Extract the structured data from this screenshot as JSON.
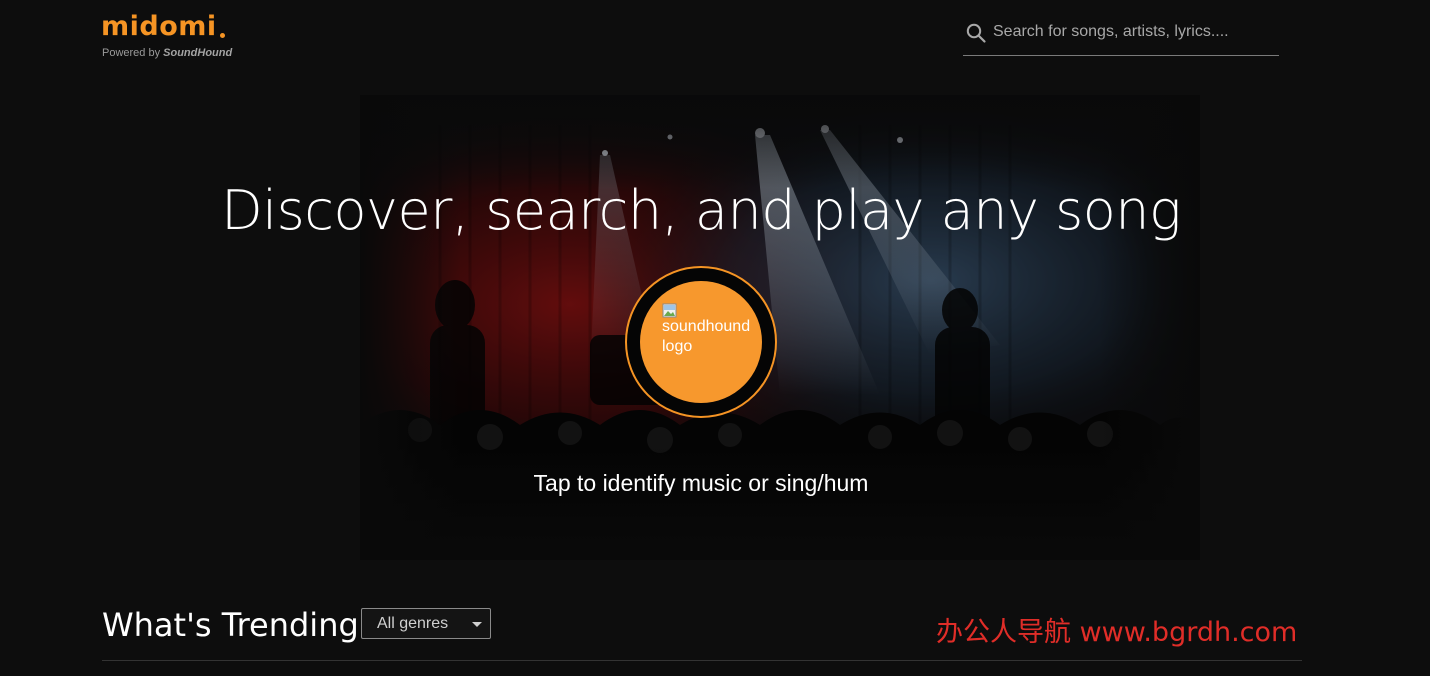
{
  "header": {
    "logo": {
      "wordmark": "midomi",
      "powered_prefix": "Powered by",
      "powered_brand": "SoundHound"
    },
    "search": {
      "placeholder": "Search for songs, artists, lyrics....",
      "value": "",
      "icon": "search-icon"
    }
  },
  "hero": {
    "title": "Discover, search, and play any song",
    "listen_button": {
      "image_alt": "soundhound logo",
      "icon": "broken-image-icon"
    },
    "tap_text": "Tap to identify music or sing/hum"
  },
  "trending": {
    "title": "What's Trending",
    "genre_select": {
      "selected": "All genres"
    }
  },
  "watermark": "办公人导航 www.bgrdh.com",
  "colors": {
    "brand_orange": "#f59424",
    "button_fill": "#f7982d",
    "background": "#0d0d0d",
    "watermark_red": "#e02d28"
  }
}
